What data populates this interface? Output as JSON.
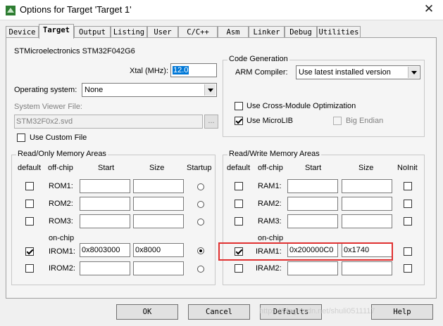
{
  "window": {
    "title": "Options for Target 'Target 1'",
    "close_label": "✕"
  },
  "tabs": [
    "Device",
    "Target",
    "Output",
    "Listing",
    "User",
    "C/C++",
    "Asm",
    "Linker",
    "Debug",
    "Utilities"
  ],
  "active_tab": "Target",
  "device": "STMicroelectronics STM32F042G6",
  "xtal": {
    "label": "Xtal (MHz):",
    "value": "12.0"
  },
  "os": {
    "label": "Operating system:",
    "value": "None"
  },
  "svd": {
    "label": "System Viewer File:",
    "value": "STM32F0x2.svd",
    "browse_label": "..."
  },
  "custom_file": {
    "label": "Use Custom File",
    "checked": false
  },
  "codegen": {
    "title": "Code Generation",
    "compiler_label": "ARM Compiler:",
    "compiler_value": "Use latest installed version",
    "cross_module": {
      "label": "Use Cross-Module Optimization",
      "checked": false
    },
    "microlib": {
      "label": "Use MicroLIB",
      "checked": true
    },
    "big_endian": {
      "label": "Big Endian",
      "checked": false
    }
  },
  "ro_memory": {
    "title": "Read/Only Memory Areas",
    "headers": {
      "default": "default",
      "offchip": "off-chip",
      "start": "Start",
      "size": "Size",
      "startup": "Startup"
    },
    "onchip_label": "on-chip",
    "rows": [
      {
        "name": "ROM1:",
        "start": "",
        "size": ""
      },
      {
        "name": "ROM2:",
        "start": "",
        "size": ""
      },
      {
        "name": "ROM3:",
        "start": "",
        "size": ""
      },
      {
        "name": "IROM1:",
        "start": "0x8003000",
        "size": "0x8000"
      },
      {
        "name": "IROM2:",
        "start": "",
        "size": ""
      }
    ]
  },
  "rw_memory": {
    "title": "Read/Write Memory Areas",
    "headers": {
      "default": "default",
      "offchip": "off-chip",
      "start": "Start",
      "size": "Size",
      "noinit": "NoInit"
    },
    "onchip_label": "on-chip",
    "rows": [
      {
        "name": "RAM1:",
        "start": "",
        "size": ""
      },
      {
        "name": "RAM2:",
        "start": "",
        "size": ""
      },
      {
        "name": "RAM3:",
        "start": "",
        "size": ""
      },
      {
        "name": "IRAM1:",
        "start": "0x200000C0",
        "size": "0x1740"
      },
      {
        "name": "IRAM2:",
        "start": "",
        "size": ""
      }
    ]
  },
  "buttons": {
    "ok": "OK",
    "cancel": "Cancel",
    "defaults": "Defaults",
    "help": "Help"
  },
  "watermark": "https://blog.csdn.net/shuli0511117",
  "colors": {
    "highlight": "#e03030",
    "selection": "#0078d7"
  }
}
